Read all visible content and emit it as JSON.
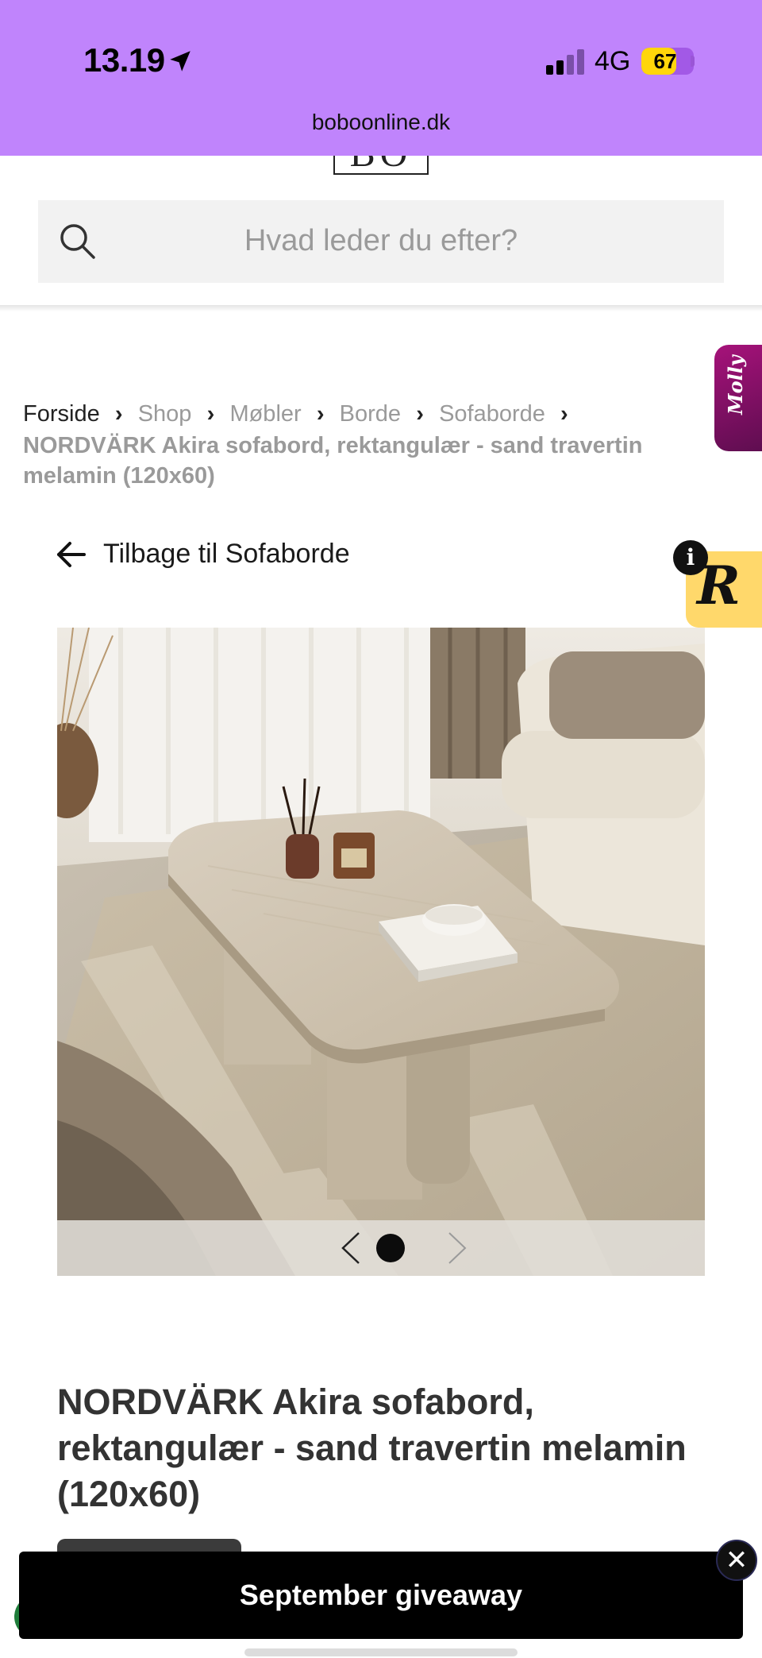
{
  "status_bar": {
    "time": "13.19",
    "network": "4G",
    "battery": "67",
    "battery_level": 0.67,
    "url": "boboonline.dk",
    "background_color": "#c084fc"
  },
  "header": {
    "logo_text": "BO",
    "search": {
      "placeholder": "Hvad leder du efter?"
    }
  },
  "breadcrumb": {
    "items": [
      "Forside",
      "Shop",
      "Møbler",
      "Borde",
      "Sofaborde"
    ],
    "current": "NORDVÄRK Akira sofabord, rektangulær - sand travertin melamin (120x60)"
  },
  "back_link": {
    "label": "Tilbage til Sofaborde"
  },
  "widgets": {
    "molly_label": "Molly",
    "info_label": "i",
    "r_label": "R"
  },
  "gallery": {
    "prev_icon": "chevron-left-icon",
    "next_icon": "chevron-right-icon",
    "image_icon": "coffee-table-photo"
  },
  "product": {
    "title": "NORDVÄRK Akira sofabord, rektangulær - sand travertin melamin (120x60)"
  },
  "banner": {
    "label": "September giveaway",
    "close_label": "✕"
  },
  "colors": {
    "accent_purple": "#c084fc",
    "battery_yellow": "#ffd60a",
    "molly_magenta": "#a6127a",
    "r_widget_yellow": "#ffd86b",
    "banner_black": "#000000"
  }
}
